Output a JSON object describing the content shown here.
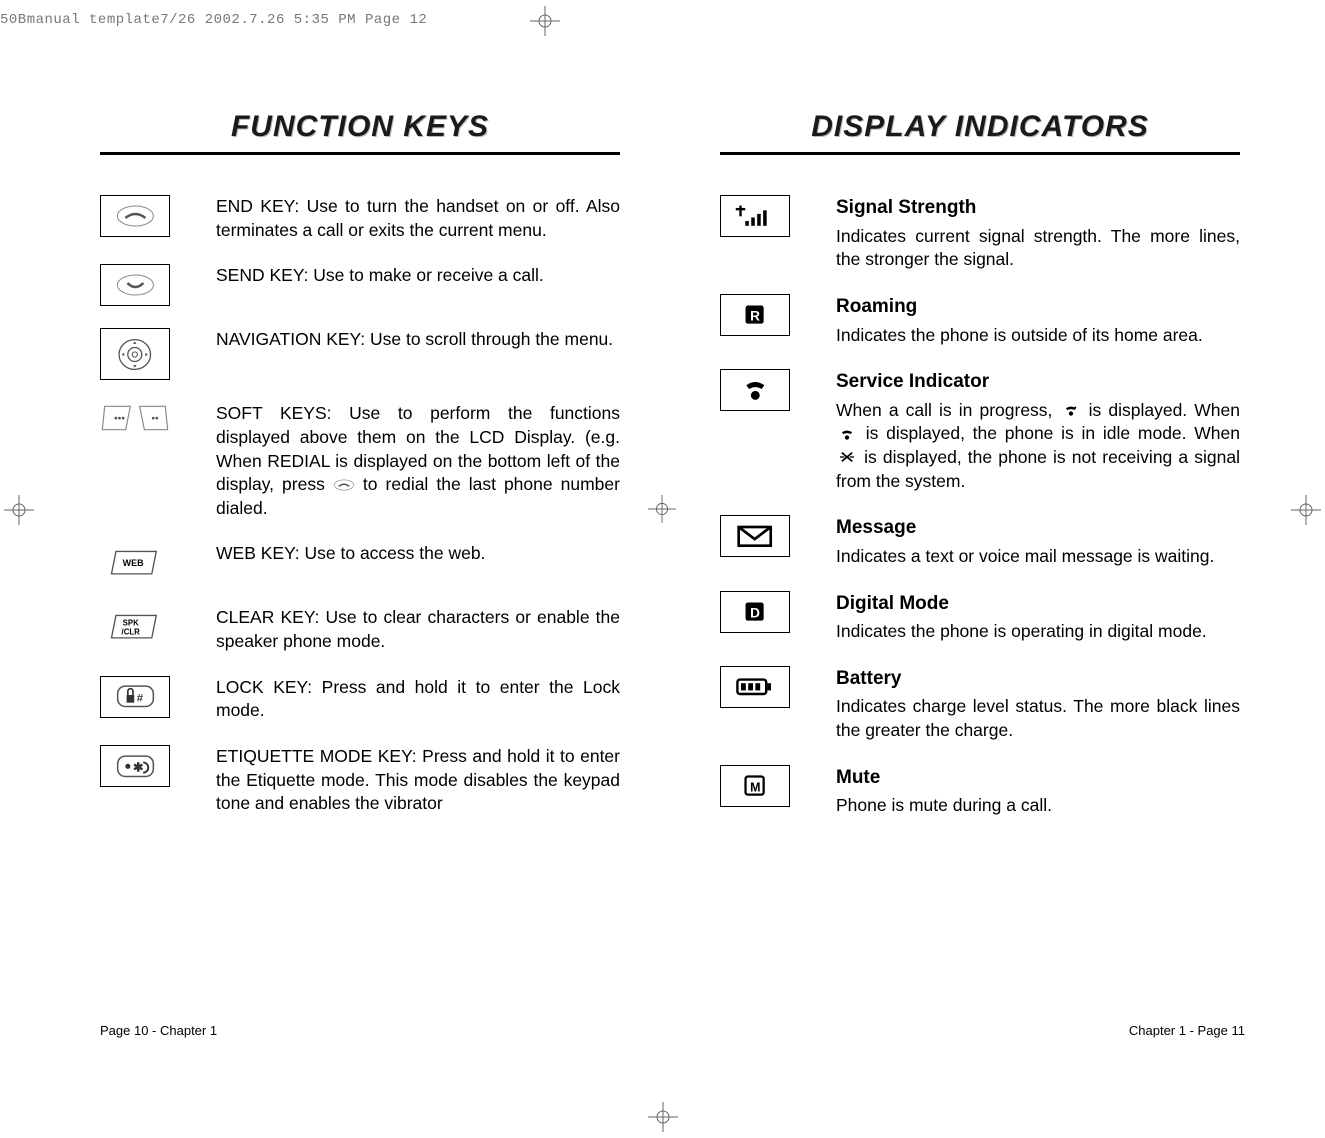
{
  "header": "50Bmanual template7/26  2002.7.26  5:35 PM  Page 12",
  "left": {
    "title": "FUNCTION KEYS",
    "items": [
      {
        "icon": "end-key-icon",
        "text": "END KEY: Use to turn the handset on or off. Also terminates a call or exits the current menu."
      },
      {
        "icon": "send-key-icon",
        "text": "SEND KEY: Use to make or receive a call."
      },
      {
        "icon": "nav-key-icon",
        "text": "NAVIGATION KEY: Use to scroll through the menu."
      },
      {
        "icon": "soft-keys-icon",
        "text_a": "SOFT KEYS: Use to perform the functions displayed above them on the LCD Display. (e.g. When REDIAL is displayed on the bottom left of the display, press ",
        "text_b": " to redial the last phone number dialed."
      },
      {
        "icon": "web-key-icon",
        "text": "WEB KEY: Use to access the web."
      },
      {
        "icon": "clear-key-icon",
        "text": "CLEAR KEY: Use to clear characters or enable the speaker phone mode."
      },
      {
        "icon": "lock-key-icon",
        "text": "LOCK KEY: Press and hold it to enter the Lock mode."
      },
      {
        "icon": "etiquette-key-icon",
        "text": "ETIQUETTE MODE KEY: Press and hold it to enter the Etiquette mode. This mode disables the keypad tone and enables the vibrator"
      }
    ]
  },
  "right": {
    "title": "DISPLAY INDICATORS",
    "items": [
      {
        "icon": "signal-icon",
        "title": "Signal Strength",
        "text": "Indicates current signal strength. The more lines, the stronger the signal."
      },
      {
        "icon": "roaming-icon",
        "title": "Roaming",
        "text": "Indicates the phone is outside of its home area."
      },
      {
        "icon": "service-icon",
        "title": "Service Indicator",
        "text_a": "When a call is in progress, ",
        "text_b": " is displayed. When ",
        "text_c": " is displayed, the phone is in idle mode. When ",
        "text_d": " is displayed, the phone is not receiving a signal from the system."
      },
      {
        "icon": "message-icon",
        "title": "Message",
        "text": "Indicates a text or voice mail message is waiting."
      },
      {
        "icon": "digital-icon",
        "title": "Digital Mode",
        "text": "Indicates the phone is operating in digital mode."
      },
      {
        "icon": "battery-icon",
        "title": "Battery",
        "text": "Indicates charge level status. The more black lines the greater the charge."
      },
      {
        "icon": "mute-icon",
        "title": "Mute",
        "text": "Phone is mute during a call."
      }
    ]
  },
  "footer_left": "Page 10 - Chapter 1",
  "footer_right": "Chapter 1 - Page 11"
}
